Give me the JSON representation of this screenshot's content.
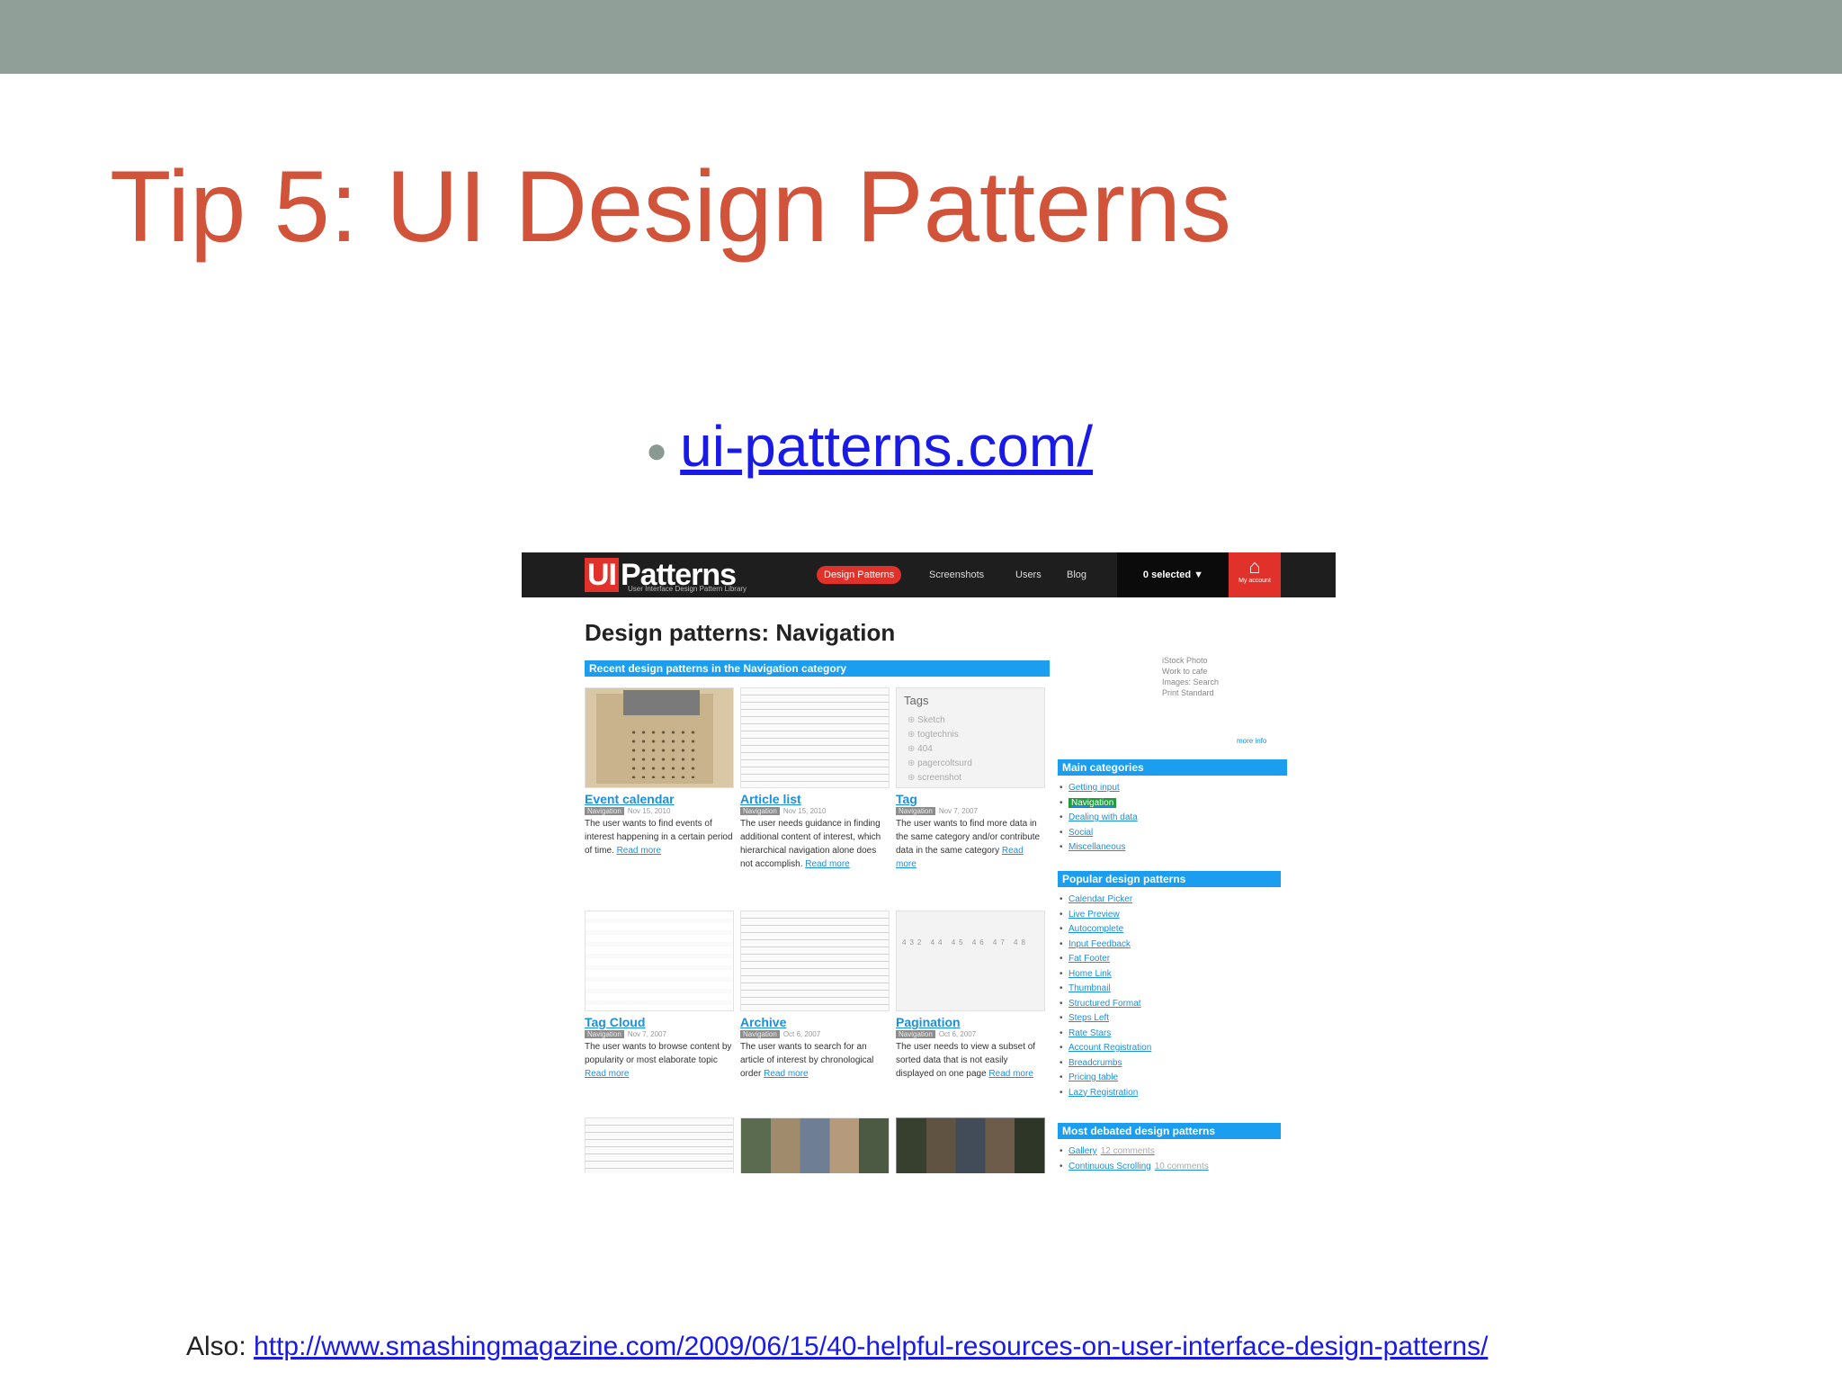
{
  "slide": {
    "title": "Tip 5: UI Design Patterns",
    "bullet_link": "ui-patterns.com/",
    "also_label": "Also:",
    "also_link": "http://www.smashingmagazine.com/2009/06/15/40-helpful-resources-on-user-interface-design-patterns/",
    "colors": {
      "topbar": "#909f97",
      "title": "#d0533a",
      "link": "#1a1ae6"
    }
  },
  "site": {
    "logo_ui": "UI",
    "logo_patterns": "Patterns",
    "logo_sub": "User Interface Design Pattern Library",
    "nav": [
      "Design Patterns",
      "Screenshots",
      "Users",
      "Blog"
    ],
    "selected": "0 selected ▼",
    "account_label": "My account",
    "page_heading": "Design patterns: Navigation",
    "recent_bar": "Recent design patterns in the Navigation category",
    "cards": [
      {
        "title": "Event calendar",
        "badge": "Navigation",
        "date": "Nov 15, 2010",
        "desc": "The user wants to find events of interest happening in a certain period of time.",
        "read_more": "Read more"
      },
      {
        "title": "Article list",
        "badge": "Navigation",
        "date": "Nov 15, 2010",
        "desc": "The user needs guidance in finding additional content of interest, which hierarchical navigation alone does not accomplish.",
        "read_more": "Read more"
      },
      {
        "title": "Tag",
        "badge": "Navigation",
        "date": "Nov 7, 2007",
        "desc": "The user wants to find more data in the same category and/or contribute data in the same category",
        "read_more": "Read more"
      },
      {
        "title": "Tag Cloud",
        "badge": "Navigation",
        "date": "Nov 7, 2007",
        "desc": "The user wants to browse content by popularity or most elaborate topic",
        "read_more": "Read more"
      },
      {
        "title": "Archive",
        "badge": "Navigation",
        "date": "Oct 6, 2007",
        "desc": "The user wants to search for an article of interest by chronological order",
        "read_more": "Read more"
      },
      {
        "title": "Pagination",
        "badge": "Navigation",
        "date": "Oct 6, 2007",
        "desc": "The user needs to view a subset of sorted data that is not easily displayed on one page",
        "read_more": "Read more"
      }
    ],
    "tags_title": "Tags",
    "tags": [
      "Sketch",
      "togtechnis",
      "404",
      "pagercoltsurd",
      "screenshot"
    ],
    "pagination_thumb": "432   44  45  46  47  48",
    "side_ad_text": "iStock Photo\nWork to cafe\nImages: Search\nPrint Standard",
    "side_more": "more info",
    "main_categories_title": "Main categories",
    "main_categories": [
      "Getting input",
      "Navigation",
      "Dealing with data",
      "Social",
      "Miscellaneous"
    ],
    "popular_title": "Popular design patterns",
    "popular": [
      "Calendar Picker",
      "Live Preview",
      "Autocomplete",
      "Input Feedback",
      "Fat Footer",
      "Home Link",
      "Thumbnail",
      "Structured Format",
      "Steps Left",
      "Rate Stars",
      "Account Registration",
      "Breadcrumbs",
      "Pricing table",
      "Lazy Registration"
    ],
    "debated_title": "Most debated design patterns",
    "debated": [
      {
        "name": "Gallery",
        "count": "12 comments"
      },
      {
        "name": "Continuous Scrolling",
        "count": "10 comments"
      }
    ]
  }
}
